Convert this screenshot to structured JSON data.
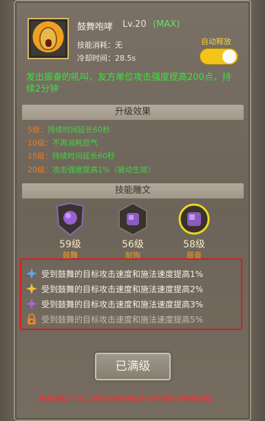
{
  "skill": {
    "name": "鼓舞咆哮",
    "level": "Lv.20",
    "max_tag": "(MAX)",
    "cost": "技能消耗：无",
    "cooldown": "冷却时间：28.5s",
    "auto_release_label": "自动释放",
    "auto_release_on": true,
    "description": "发出振奋的吼叫，友方单位攻击强度提高200点，持续2分钟"
  },
  "upgrade": {
    "header": "升级效果",
    "lines": [
      {
        "level": "5级：",
        "text": "持续时间延长60秒"
      },
      {
        "level": "10级：",
        "text": "不再消耗怒气"
      },
      {
        "level": "15级：",
        "text": "持续时间延长60秒"
      },
      {
        "level": "20级：",
        "text": "攻击强度提高1%（被动生效）"
      }
    ]
  },
  "glyphs": {
    "header": "技能雕文",
    "items": [
      {
        "level": "59级",
        "name": "鼓舞"
      },
      {
        "level": "56级",
        "name": "耐狗"
      },
      {
        "level": "58级",
        "name": "振奋"
      }
    ]
  },
  "bonuses": [
    {
      "text": "受到鼓舞的目标攻击速度和施法速度提高1%",
      "icon": "blue-star-icon"
    },
    {
      "text": "受到鼓舞的目标攻击速度和施法速度提高2%",
      "icon": "gold-star-icon"
    },
    {
      "text": "受到鼓舞的目标攻击速度和施法速度提高3%",
      "icon": "purple-star-icon"
    },
    {
      "text": "受到鼓舞的目标攻击速度和施法速度提高5%",
      "icon": "lock-icon"
    }
  ],
  "button": {
    "label": "已满级"
  },
  "footer": {
    "note": "技能满级后可以通过装备技能词条继续提升技能等级"
  },
  "colors": {
    "green": "#3ee23e",
    "orange": "#f07a20",
    "red": "#ff2a2a",
    "gold": "#f4c418"
  }
}
